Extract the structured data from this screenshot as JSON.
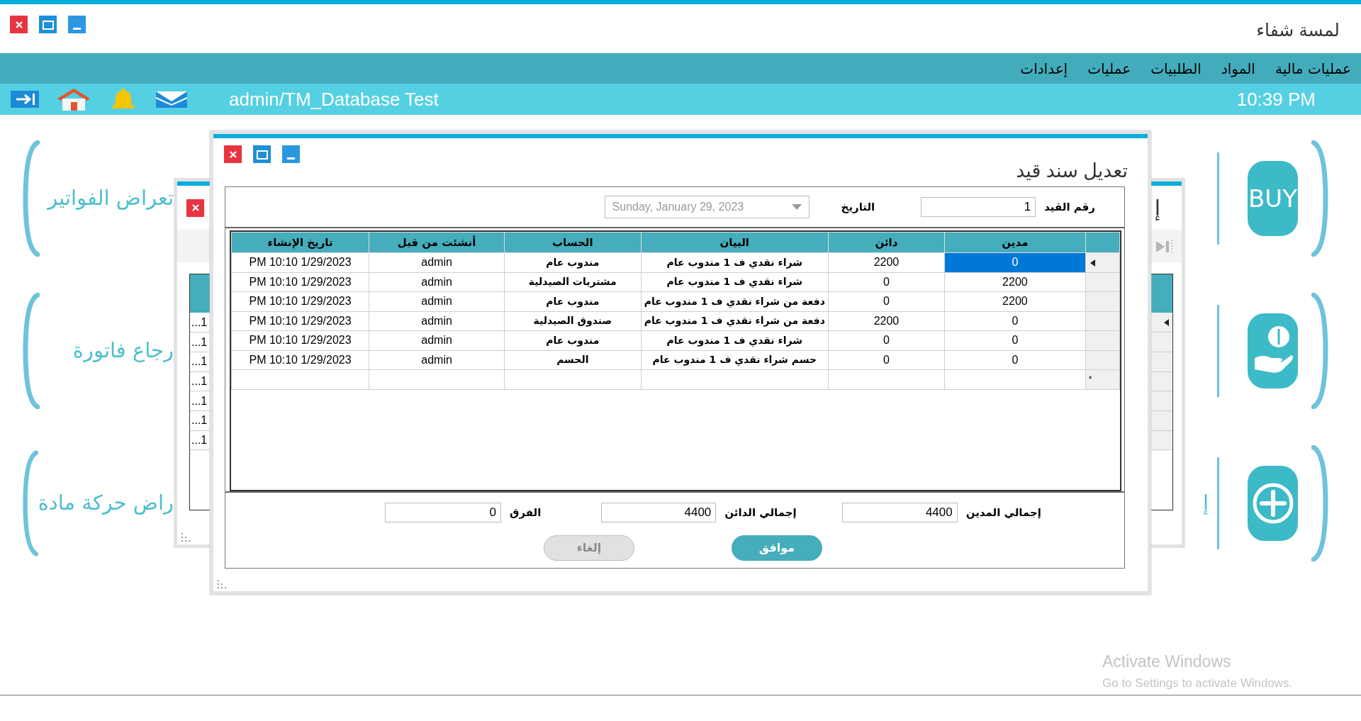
{
  "main_window": {
    "title": "لمسة شفاء"
  },
  "menu": [
    {
      "label": "عمليات مالية"
    },
    {
      "label": "المواد"
    },
    {
      "label": "الطلبيات"
    },
    {
      "label": "عمليات"
    },
    {
      "label": "إعدادات"
    }
  ],
  "toolbar": {
    "session": "admin/TM_Database Test",
    "time": "10:39 PM"
  },
  "shortcuts_left": [
    {
      "label": "تعراض الفواتير"
    },
    {
      "label": "رجاع فاتورة"
    },
    {
      "label": "راض حركة مادة"
    }
  ],
  "shortcuts_right": [
    {
      "kind": "buy",
      "text": "BUY"
    },
    {
      "kind": "money"
    },
    {
      "kind": "add",
      "label": "إ"
    }
  ],
  "back_window": {
    "heading": "إ",
    "rows": [
      {
        "text": "...1",
        "selected": true
      },
      {
        "text": "...1",
        "selected": false
      },
      {
        "text": "...1",
        "selected": false
      },
      {
        "text": "...1",
        "selected": false
      },
      {
        "text": "...1",
        "selected": false
      },
      {
        "text": "...1",
        "selected": false
      },
      {
        "text": "...1",
        "selected": false
      }
    ]
  },
  "dialog": {
    "title": "تعديل سند قيد",
    "entry_no_label": "رقم القيد",
    "entry_no": "1",
    "date_label": "التاريخ",
    "date": {
      "value": "Sunday, January 29, 2023",
      "disabled": true
    },
    "columns": [
      "مدين",
      "دائن",
      "البيان",
      "الحساب",
      "أنشئت من قبل",
      "تاريخ الإنشاء"
    ],
    "rows": [
      {
        "cells": [
          "0",
          "2200",
          "شراء نقدي ف 1 مندوب عام",
          "مندوب عام",
          "admin",
          "PM 10:10 1/29/2023"
        ],
        "selected": true
      },
      {
        "cells": [
          "2200",
          "0",
          "شراء نقدي ف 1 مندوب عام",
          "مشتريات الصيدلية",
          "admin",
          "PM 10:10 1/29/2023"
        ],
        "selected": false
      },
      {
        "cells": [
          "2200",
          "0",
          "دفعة من شراء نقدي ف 1 مندوب عام",
          "مندوب عام",
          "admin",
          "PM 10:10 1/29/2023"
        ],
        "selected": false
      },
      {
        "cells": [
          "0",
          "2200",
          "دفعة من شراء نقدي ف 1 مندوب عام",
          "صندوق الصيدلية",
          "admin",
          "PM 10:10 1/29/2023"
        ],
        "selected": false
      },
      {
        "cells": [
          "0",
          "0",
          "شراء نقدي ف 1 مندوب عام",
          "مندوب عام",
          "admin",
          "PM 10:10 1/29/2023"
        ],
        "selected": false
      },
      {
        "cells": [
          "0",
          "0",
          "حسم شراء نقدي ف 1 مندوب عام",
          "الحسم",
          "admin",
          "PM 10:10 1/29/2023"
        ],
        "selected": false
      }
    ],
    "new_row_marker": "*",
    "totals": [
      {
        "label": "إجمالي المدين",
        "value": "4400"
      },
      {
        "label": "إجمالي الدائن",
        "value": "4400"
      },
      {
        "label": "الفرق",
        "value": "0"
      }
    ],
    "buttons": [
      {
        "label": "موافق",
        "disabled": false
      },
      {
        "label": "إلغاء",
        "disabled": true
      }
    ]
  },
  "activation_notice": {
    "title": "Activate Windows",
    "text": "Go to Settings to activate Windows."
  }
}
